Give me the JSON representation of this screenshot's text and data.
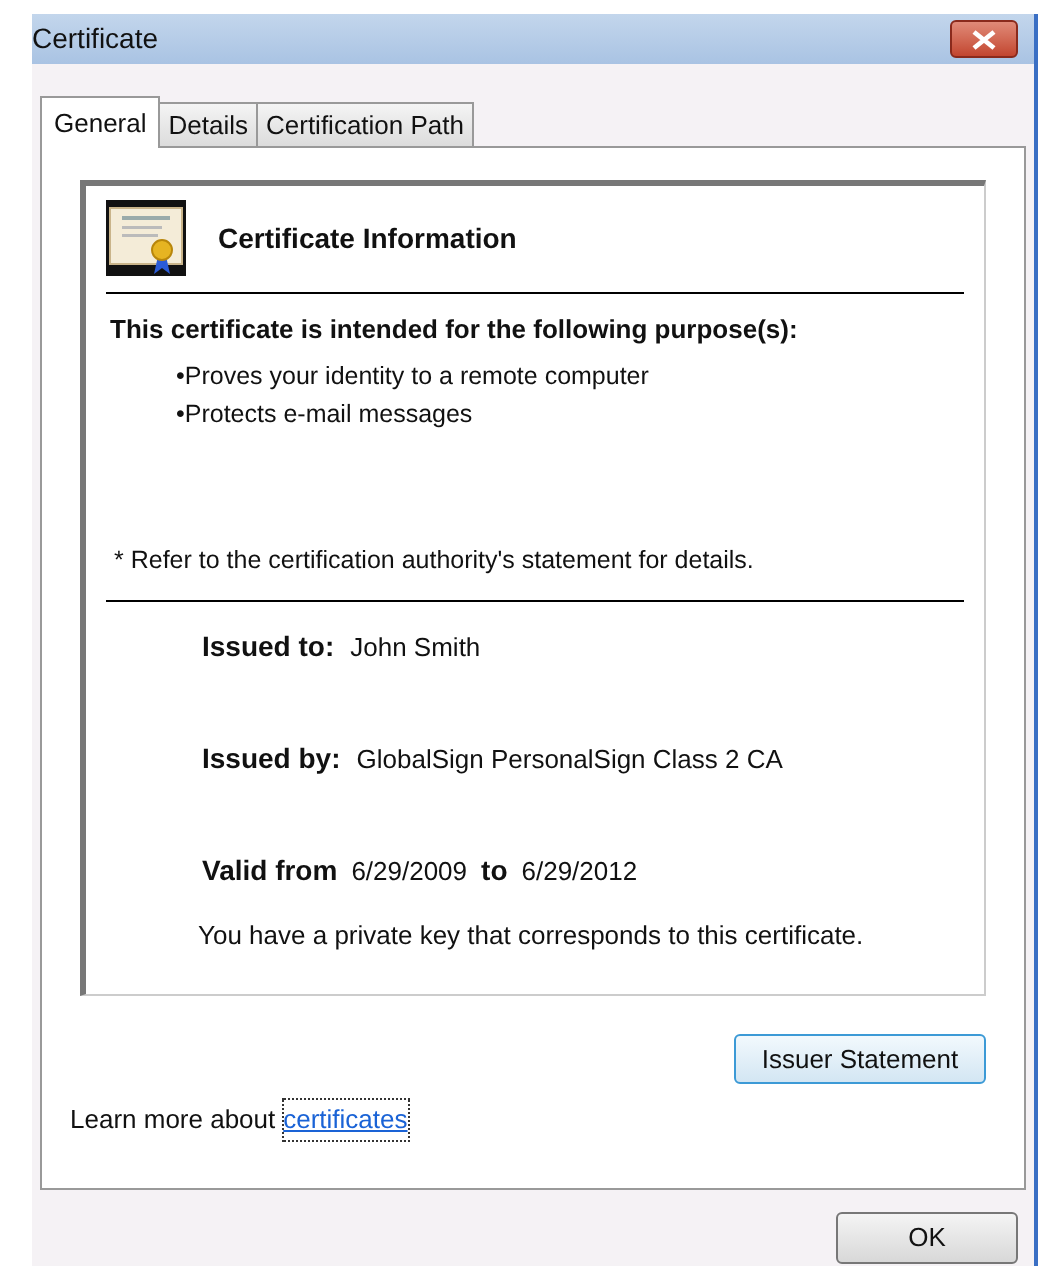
{
  "window": {
    "title": "Certificate"
  },
  "tabs": [
    {
      "label": "General",
      "selected": true
    },
    {
      "label": "Details",
      "selected": false
    },
    {
      "label": "Certification Path",
      "selected": false
    }
  ],
  "certificate": {
    "heading": "Certificate Information",
    "purpose_title": "This certificate is intended for the following purpose(s):",
    "purposes": [
      "•Proves your identity to a remote computer",
      "•Protects e-mail messages"
    ],
    "footnote": "* Refer to the certification authority's statement for details.",
    "issued_to": {
      "label": "Issued to:",
      "value": "John Smith"
    },
    "issued_by": {
      "label": "Issued by:",
      "value": "GlobalSign PersonalSign Class 2 CA"
    },
    "validity": {
      "label": "Valid from",
      "from": "6/29/2009",
      "to_label": "to",
      "to": "6/29/2012"
    },
    "key_note": "You have a private key that corresponds to this certificate."
  },
  "issuer_button": "Issuer Statement",
  "learn_more": {
    "text": "Learn more about",
    "link": "certificates"
  },
  "ok_button": "OK"
}
